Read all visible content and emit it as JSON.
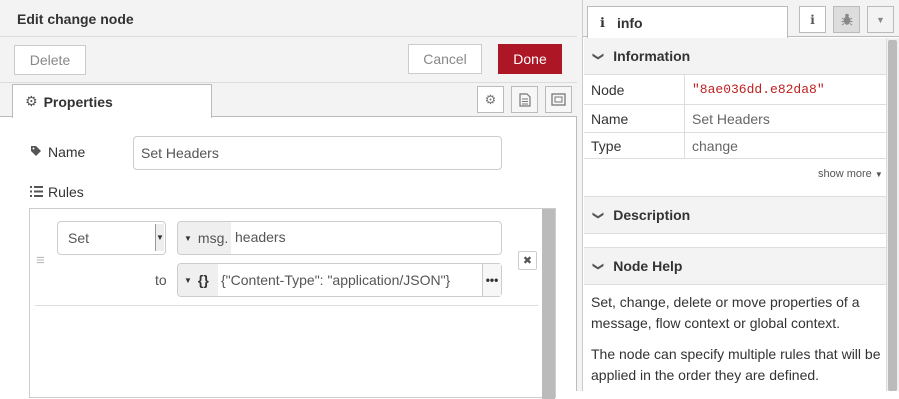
{
  "tray": {
    "title": "Edit change node",
    "delete_label": "Delete",
    "cancel_label": "Cancel",
    "done_label": "Done",
    "tab_properties": "Properties",
    "name_label": "Name",
    "name_value": "Set Headers",
    "rules_label": "Rules",
    "rule": {
      "action": "Set",
      "prop_type": "msg.",
      "prop_value": "headers",
      "to_label": "to",
      "value_type": "{}",
      "value_text": "{\"Content-Type\": \"application/JSON\"}",
      "expand_label": "•••"
    }
  },
  "sidebar": {
    "tab_label": "info",
    "info_section": "Information",
    "rows": [
      {
        "key": "Node",
        "value": "\"8ae036dd.e82da8\""
      },
      {
        "key": "Name",
        "value": "Set Headers"
      },
      {
        "key": "Type",
        "value": "change"
      }
    ],
    "show_more": "show more",
    "description_section": "Description",
    "help_section": "Node Help",
    "help_paragraphs": [
      "Set, change, delete or move properties of a message, flow context or global context.",
      "The node can specify multiple rules that will be applied in the order they are defined."
    ]
  },
  "colors": {
    "accent": "#ad1625",
    "node_id": "#c02020"
  },
  "icons": [
    "gear-icon",
    "tag-icon",
    "list-icon",
    "document-icon",
    "frame-icon",
    "info-icon",
    "bug-icon",
    "chevron-down-icon",
    "close-icon",
    "drag-handle-icon"
  ]
}
